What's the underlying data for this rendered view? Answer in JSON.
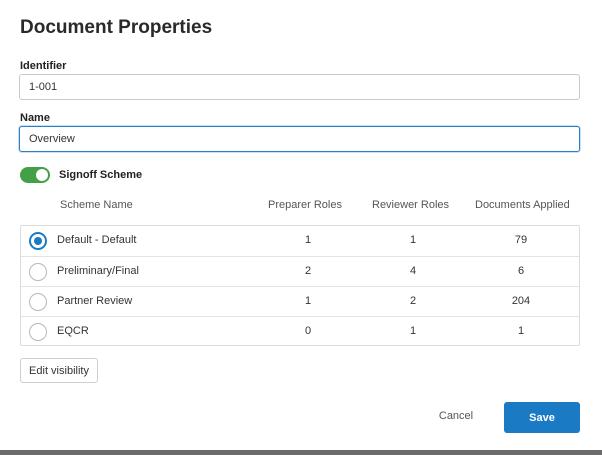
{
  "dialog": {
    "title": "Document Properties"
  },
  "identifier": {
    "label": "Identifier",
    "value": "1-001"
  },
  "name": {
    "label": "Name",
    "value": "Overview"
  },
  "signoff": {
    "label": "Signoff Scheme",
    "enabled": true,
    "toggle_color": "#43a047"
  },
  "table": {
    "columns": [
      "Scheme Name",
      "Preparer Roles",
      "Reviewer Roles",
      "Documents Applied"
    ],
    "rows": [
      {
        "name": "Default - Default",
        "preparer": "1",
        "reviewer": "1",
        "documents": "79",
        "selected": true
      },
      {
        "name": "Preliminary/Final",
        "preparer": "2",
        "reviewer": "4",
        "documents": "6",
        "selected": false
      },
      {
        "name": "Partner Review",
        "preparer": "1",
        "reviewer": "2",
        "documents": "204",
        "selected": false
      },
      {
        "name": "EQCR",
        "preparer": "0",
        "reviewer": "1",
        "documents": "1",
        "selected": false
      }
    ]
  },
  "buttons": {
    "edit_visibility": "Edit visibility",
    "cancel": "Cancel",
    "save": "Save"
  },
  "colors": {
    "accent": "#1a7bc4",
    "focus_border": "#2a7fc9"
  }
}
